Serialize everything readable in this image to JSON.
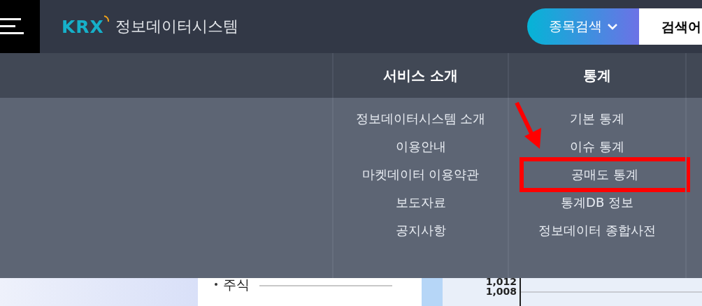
{
  "header": {
    "logo_text": "KRX",
    "site_title": "정보데이터시스템",
    "search_type": {
      "label": "종목검색"
    },
    "search": {
      "placeholder": "검색어"
    }
  },
  "menu": [
    {
      "title": "서비스 소개",
      "items": [
        {
          "label": "정보데이터시스템 소개",
          "highlighted": false
        },
        {
          "label": "이용안내",
          "highlighted": false
        },
        {
          "label": "마켓데이터 이용약관",
          "highlighted": false
        },
        {
          "label": "보도자료",
          "highlighted": false
        },
        {
          "label": "공지사항",
          "highlighted": false
        }
      ]
    },
    {
      "title": "통계",
      "items": [
        {
          "label": "기본 통계",
          "highlighted": false
        },
        {
          "label": "이슈 통계",
          "highlighted": false
        },
        {
          "label": "공매도 통계",
          "highlighted": true
        },
        {
          "label": "통계DB 정보",
          "highlighted": false
        },
        {
          "label": "정보데이터 종합사전",
          "highlighted": false
        }
      ]
    }
  ],
  "background_content": {
    "list_item": "주식",
    "axis_ticks": [
      "1,012",
      "1,008"
    ]
  }
}
